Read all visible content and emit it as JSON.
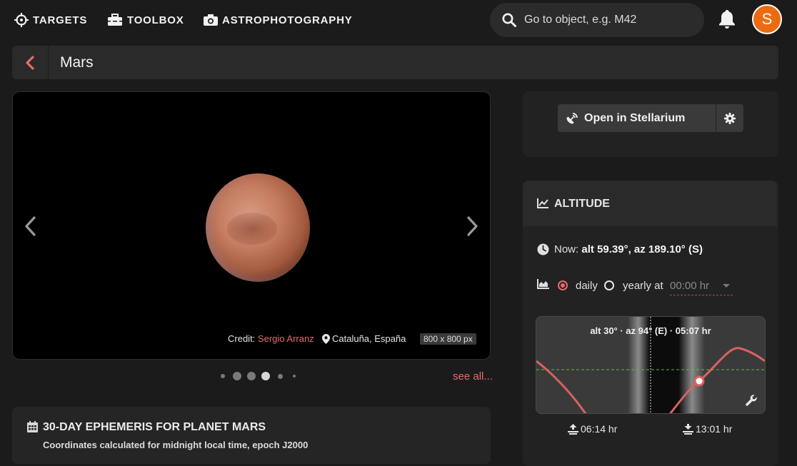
{
  "nav": {
    "targets": "TARGETS",
    "toolbox": "TOOLBOX",
    "astrophotography": "ASTROPHOTOGRAPHY"
  },
  "search": {
    "placeholder": "Go to object, e.g. M42"
  },
  "user": {
    "avatar_letter": "S",
    "avatar_color": "#ec6b10"
  },
  "page": {
    "title": "Mars"
  },
  "gallery": {
    "credit_label": "Credit:",
    "credit_author": "Sergio Arranz",
    "location": "Cataluña, España",
    "dimensions": "800 x 800 px",
    "see_all": "see all...",
    "slide_count": 6,
    "active_slide": 4
  },
  "ephemeris": {
    "title": "30-DAY EPHEMERIS FOR PLANET MARS",
    "subtitle": "Coordinates calculated for midnight local time, epoch J2000"
  },
  "stellarium": {
    "button_label": "Open in Stellarium"
  },
  "altitude": {
    "title": "ALTITUDE",
    "now_label": "Now:",
    "now_value": "alt 59.39°, az 189.10° (S)",
    "option_daily": "daily",
    "option_yearly": "yearly at",
    "selected_option": "daily",
    "time_value": "00:00 hr",
    "chart_readout": "alt 30° · az 94° (E) · 05:07 hr",
    "rise_time": "06:14 hr",
    "set_time": "13:01 hr"
  },
  "colors": {
    "accent": "#e56c6c",
    "background": "#1b1b1b",
    "panel": "#2a2a2a"
  }
}
